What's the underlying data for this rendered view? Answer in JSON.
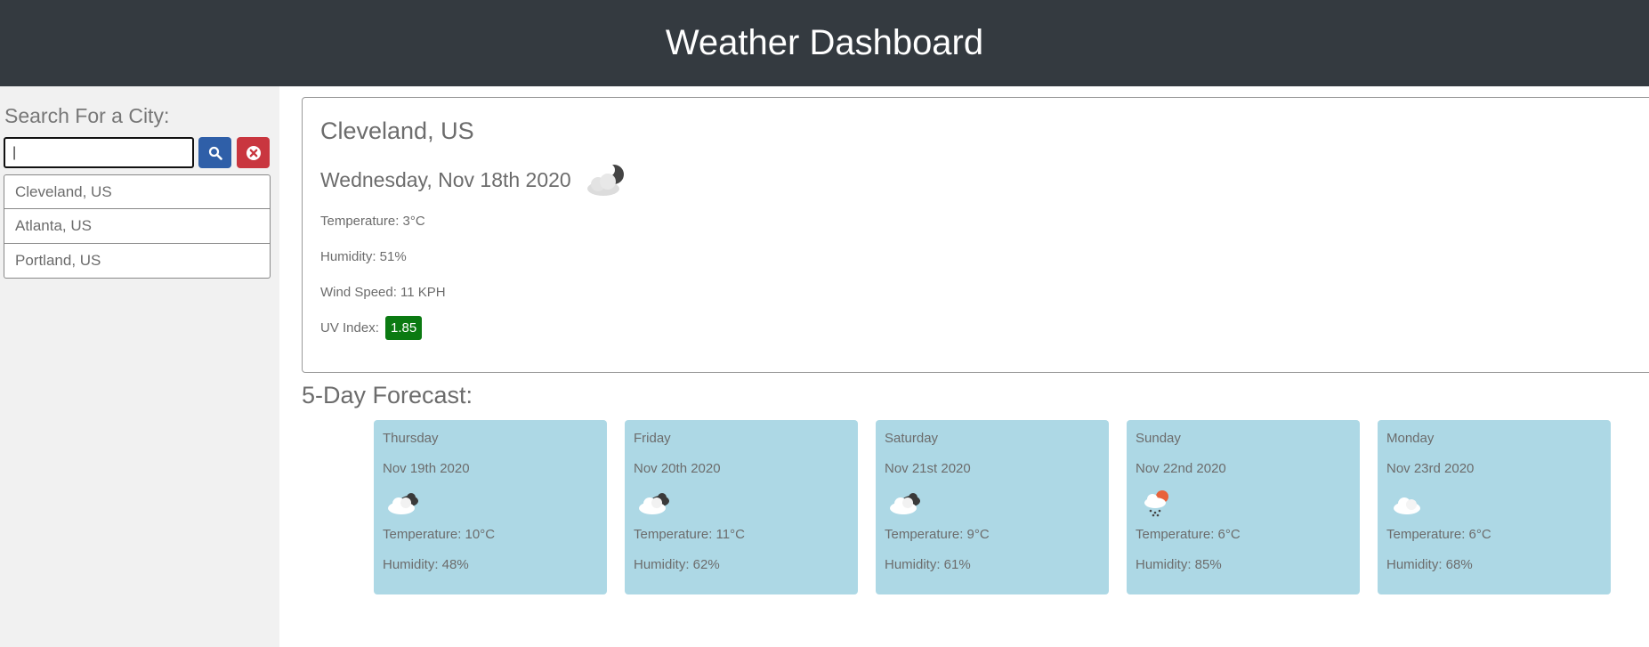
{
  "header": {
    "title": "Weather Dashboard"
  },
  "sidebar": {
    "search_label": "Search For a City:",
    "search_value": "|",
    "history": [
      "Cleveland, US",
      "Atlanta, US",
      "Portland, US"
    ]
  },
  "current": {
    "city": "Cleveland, US",
    "date": "Wednesday, Nov 18th 2020",
    "icon": "cloud-night-icon",
    "temperature": "Temperature: 3°C",
    "humidity": "Humidity: 51%",
    "wind": "Wind Speed: 11 KPH",
    "uv_label": "UV Index:",
    "uv_value": "1.85",
    "uv_color": "#0b7a12"
  },
  "forecast": {
    "title": "5-Day Forecast:",
    "days": [
      {
        "day": "Thursday",
        "date": "Nov 19th 2020",
        "icon": "broken-clouds-icon",
        "temp": "Temperature: 10°C",
        "humidity": "Humidity: 48%"
      },
      {
        "day": "Friday",
        "date": "Nov 20th 2020",
        "icon": "broken-clouds-icon",
        "temp": "Temperature: 11°C",
        "humidity": "Humidity: 62%"
      },
      {
        "day": "Saturday",
        "date": "Nov 21st 2020",
        "icon": "broken-clouds-icon",
        "temp": "Temperature: 9°C",
        "humidity": "Humidity: 61%"
      },
      {
        "day": "Sunday",
        "date": "Nov 22nd 2020",
        "icon": "sun-rain-icon",
        "temp": "Temperature: 6°C",
        "humidity": "Humidity: 85%"
      },
      {
        "day": "Monday",
        "date": "Nov 23rd 2020",
        "icon": "cloud-icon",
        "temp": "Temperature: 6°C",
        "humidity": "Humidity: 68%"
      }
    ]
  },
  "colors": {
    "header_bg": "#343a40",
    "card_bg": "#add8e5",
    "search_button": "#2f5fa8",
    "clear_button": "#c9363f"
  }
}
